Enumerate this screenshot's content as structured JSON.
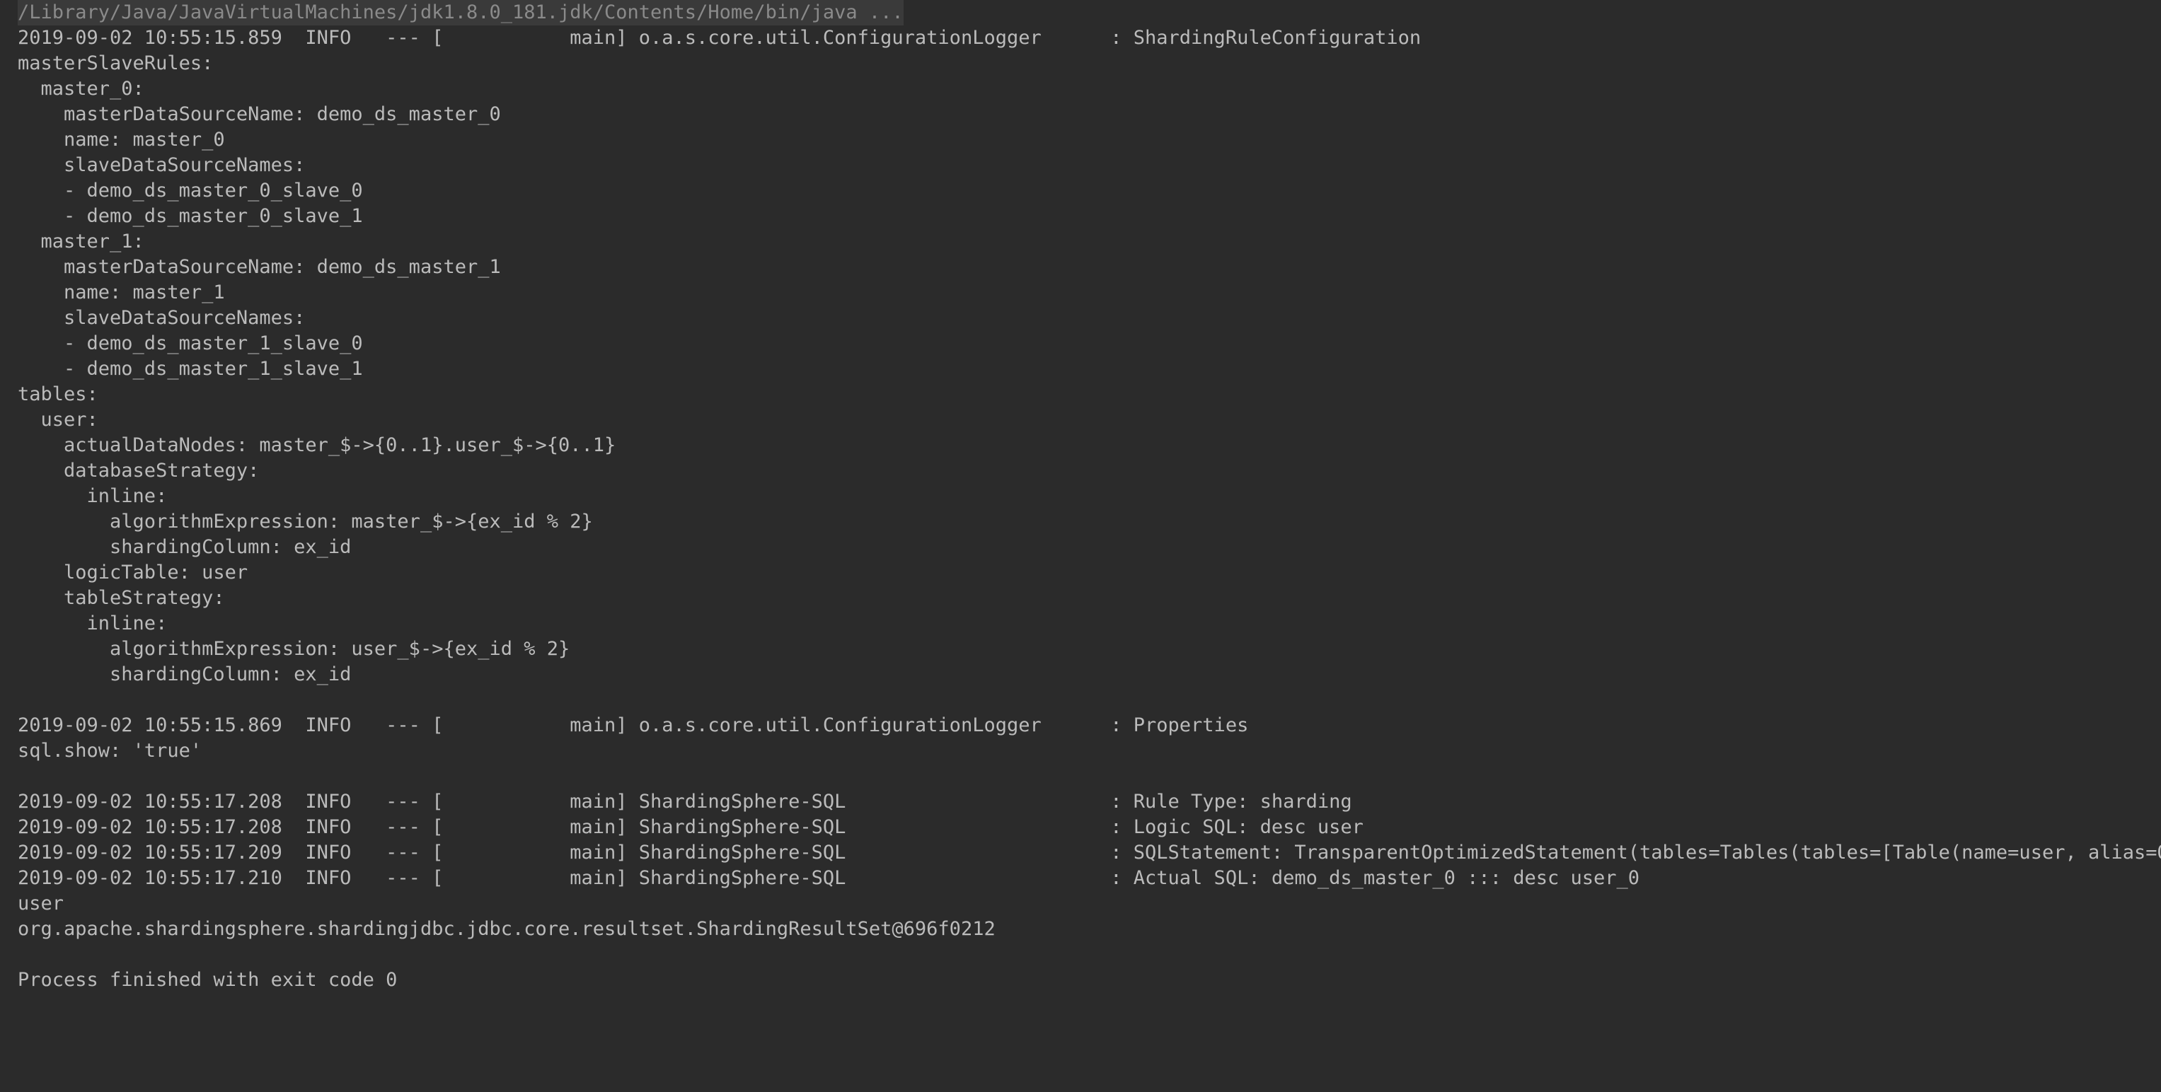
{
  "console": {
    "command_line": "/Library/Java/JavaVirtualMachines/jdk1.8.0_181.jdk/Contents/Home/bin/java ...",
    "lines": [
      "2019-09-02 10:55:15.859  INFO   --- [           main] o.a.s.core.util.ConfigurationLogger      : ShardingRuleConfiguration",
      "masterSlaveRules:",
      "  master_0:",
      "    masterDataSourceName: demo_ds_master_0",
      "    name: master_0",
      "    slaveDataSourceNames:",
      "    - demo_ds_master_0_slave_0",
      "    - demo_ds_master_0_slave_1",
      "  master_1:",
      "    masterDataSourceName: demo_ds_master_1",
      "    name: master_1",
      "    slaveDataSourceNames:",
      "    - demo_ds_master_1_slave_0",
      "    - demo_ds_master_1_slave_1",
      "tables:",
      "  user:",
      "    actualDataNodes: master_$->{0..1}.user_$->{0..1}",
      "    databaseStrategy:",
      "      inline:",
      "        algorithmExpression: master_$->{ex_id % 2}",
      "        shardingColumn: ex_id",
      "    logicTable: user",
      "    tableStrategy:",
      "      inline:",
      "        algorithmExpression: user_$->{ex_id % 2}",
      "        shardingColumn: ex_id",
      "",
      "2019-09-02 10:55:15.869  INFO   --- [           main] o.a.s.core.util.ConfigurationLogger      : Properties",
      "sql.show: 'true'",
      "",
      "2019-09-02 10:55:17.208  INFO   --- [           main] ShardingSphere-SQL                       : Rule Type: sharding",
      "2019-09-02 10:55:17.208  INFO   --- [           main] ShardingSphere-SQL                       : Logic SQL: desc user",
      "2019-09-02 10:55:17.209  INFO   --- [           main] ShardingSphere-SQL                       : SQLStatement: TransparentOptimizedStatement(tables=Tables(tables=[Table(name=user, alias=Opt",
      "2019-09-02 10:55:17.210  INFO   --- [           main] ShardingSphere-SQL                       : Actual SQL: demo_ds_master_0 ::: desc user_0",
      "user",
      "org.apache.shardingsphere.shardingjdbc.jdbc.core.resultset.ShardingResultSet@696f0212",
      "",
      "Process finished with exit code 0"
    ]
  }
}
